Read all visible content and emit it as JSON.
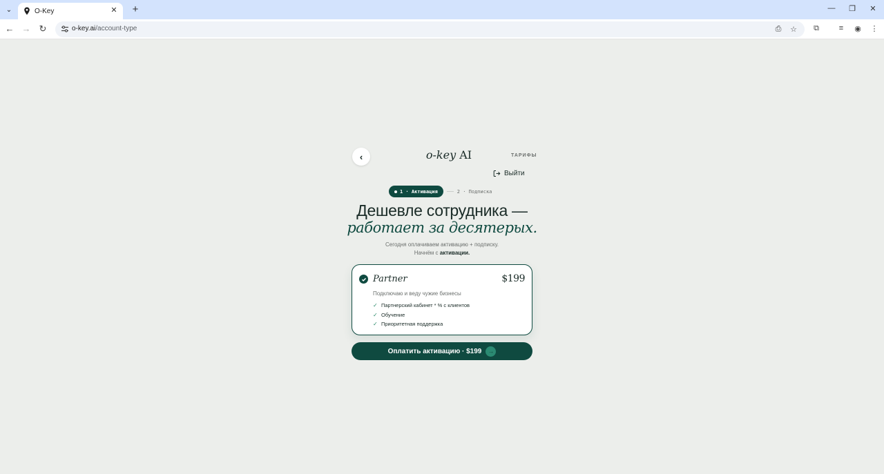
{
  "browser": {
    "tab_title": "O-Key",
    "url_host": "o-key.ai",
    "url_path": "/account-type"
  },
  "header": {
    "logo_italic": "o-key",
    "logo_rest": "AI",
    "tariffs_label": "ТАРИФЫ",
    "logout_label": "Выйти",
    "back_glyph": "‹"
  },
  "steps": {
    "active": "1 · Активация",
    "next": "2 · Подписка"
  },
  "hero": {
    "headline_line1": "Дешевле сотрудника —",
    "headline_line2": "работает за десятерых.",
    "sub_line1": "Сегодня оплачиваем активацию + подписку.",
    "sub_line2_prefix": "Начнём с",
    "sub_line2_bold": "активации."
  },
  "plan": {
    "name": "Partner",
    "price": "$199",
    "description": "Подключаю и веду чужие бизнесы",
    "features": [
      "Партнерский кабинет * % с клиентов",
      "Обучение",
      "Приоритетная поддержка"
    ]
  },
  "pay_button": {
    "label": "Оплатить активацию · $199"
  },
  "colors": {
    "accent": "#0f4a40",
    "background": "#eceeeb",
    "check": "#2a8a6a"
  }
}
